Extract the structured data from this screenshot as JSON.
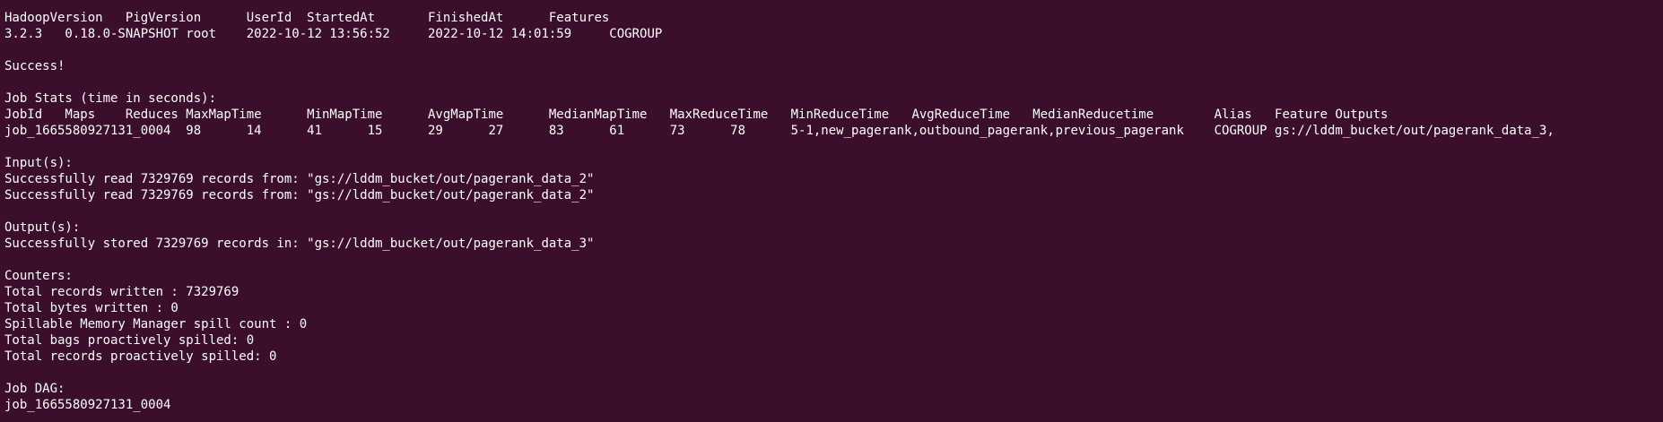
{
  "terminal": {
    "lines": [
      "HadoopVersion   PigVersion      UserId  StartedAt       FinishedAt      Features",
      "3.2.3   0.18.0-SNAPSHOT root    2022-10-12 13:56:52     2022-10-12 14:01:59     COGROUP",
      "",
      "Success!",
      "",
      "Job Stats (time in seconds):",
      "JobId   Maps    Reduces MaxMapTime      MinMapTime      AvgMapTime      MedianMapTime   MaxReduceTime   MinReduceTime   AvgReduceTime   MedianReducetime        Alias   Feature Outputs",
      "job_1665580927131_0004  98      14      41      15      29      27      83      61      73      78      5-1,new_pagerank,outbound_pagerank,previous_pagerank    COGROUP gs://lddm_bucket/out/pagerank_data_3,",
      "",
      "Input(s):",
      "Successfully read 7329769 records from: \"gs://lddm_bucket/out/pagerank_data_2\"",
      "Successfully read 7329769 records from: \"gs://lddm_bucket/out/pagerank_data_2\"",
      "",
      "Output(s):",
      "Successfully stored 7329769 records in: \"gs://lddm_bucket/out/pagerank_data_3\"",
      "",
      "Counters:",
      "Total records written : 7329769",
      "Total bytes written : 0",
      "Spillable Memory Manager spill count : 0",
      "Total bags proactively spilled: 0",
      "Total records proactively spilled: 0",
      "",
      "Job DAG:",
      "job_1665580927131_0004"
    ]
  }
}
